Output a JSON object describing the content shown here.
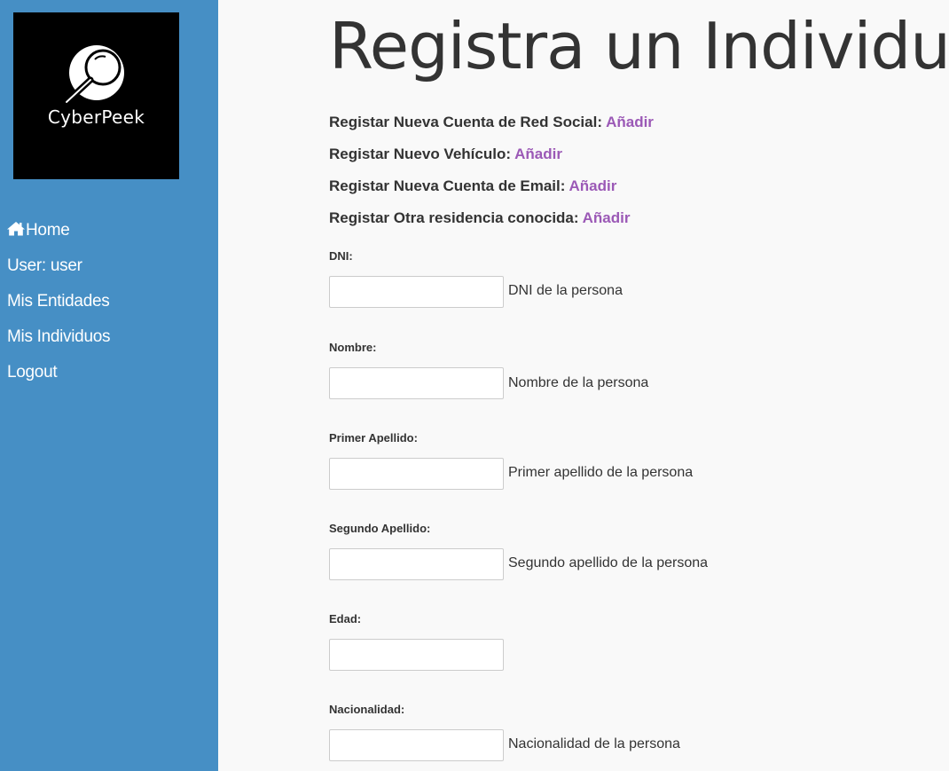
{
  "sidebar": {
    "logo_text": "CyberPeek",
    "items": [
      {
        "label": "Home",
        "icon": "home-icon"
      },
      {
        "label": "User: user"
      },
      {
        "label": "Mis Entidades"
      },
      {
        "label": "Mis Individuos"
      },
      {
        "label": "Logout"
      }
    ]
  },
  "main": {
    "title": "Registra un Individuo",
    "register_links": [
      {
        "label": "Registar Nueva Cuenta de Red Social:",
        "link": "Añadir"
      },
      {
        "label": "Registar Nuevo Vehículo:",
        "link": "Añadir"
      },
      {
        "label": "Registar Nueva Cuenta de Email:",
        "link": "Añadir"
      },
      {
        "label": "Registar Otra residencia conocida:",
        "link": "Añadir"
      }
    ],
    "fields": [
      {
        "label": "DNI:",
        "value": "",
        "help": "DNI de la persona"
      },
      {
        "label": "Nombre:",
        "value": "",
        "help": "Nombre de la persona"
      },
      {
        "label": "Primer Apellido:",
        "value": "",
        "help": "Primer apellido de la persona"
      },
      {
        "label": "Segundo Apellido:",
        "value": "",
        "help": "Segundo apellido de la persona"
      },
      {
        "label": "Edad:",
        "value": "",
        "help": ""
      },
      {
        "label": "Nacionalidad:",
        "value": "",
        "help": "Nacionalidad de la persona"
      }
    ]
  },
  "colors": {
    "sidebar_bg": "#468fc5",
    "link": "#9b59b6",
    "text": "#333333",
    "page_bg": "#f9f9f9"
  }
}
